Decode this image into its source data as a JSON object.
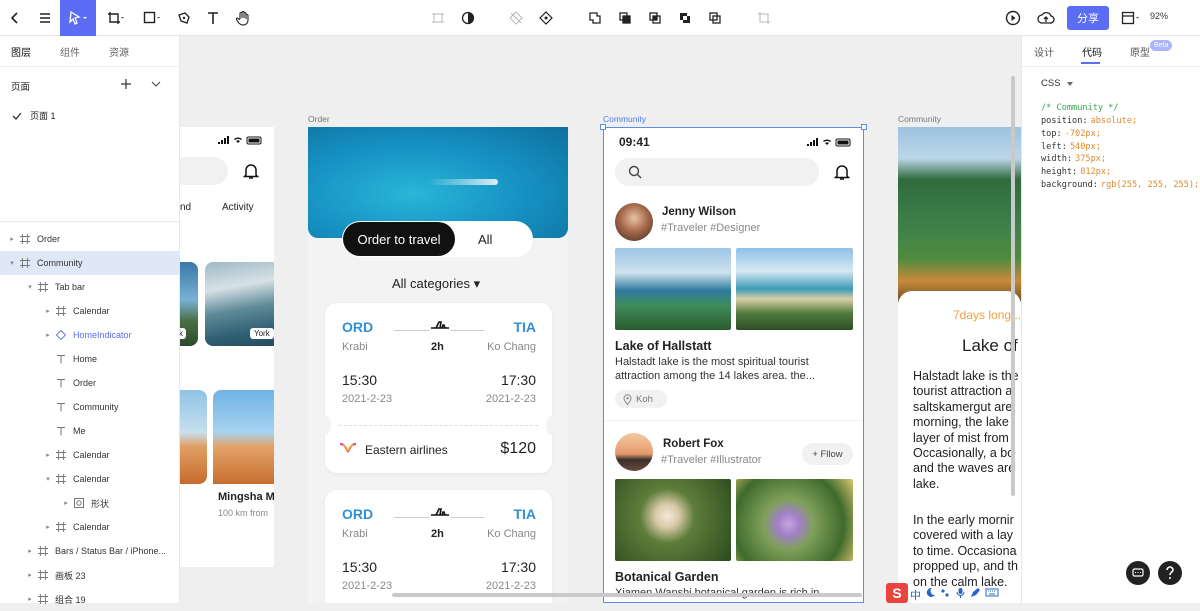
{
  "toolbar": {
    "share_label": "分享",
    "zoom": "92%"
  },
  "left_panel": {
    "tabs": [
      "图层",
      "组件",
      "资源"
    ],
    "pages_title": "页面",
    "pages": [
      "页面 1"
    ],
    "layers": [
      {
        "label": "Order",
        "level": 0,
        "caret": "▸",
        "icon": "frame"
      },
      {
        "label": "Community",
        "level": 0,
        "caret": "▾",
        "icon": "frame",
        "selected": true
      },
      {
        "label": "Tab bar",
        "level": 1,
        "caret": "▾",
        "icon": "frame"
      },
      {
        "label": "Calendar",
        "level": 2,
        "caret": "▸",
        "icon": "frame"
      },
      {
        "label": "HomeIndicator",
        "level": 2,
        "caret": "▸",
        "icon": "component",
        "accent": true
      },
      {
        "label": "Home",
        "level": 2,
        "caret": "",
        "icon": "text"
      },
      {
        "label": "Order",
        "level": 2,
        "caret": "",
        "icon": "text"
      },
      {
        "label": "Community",
        "level": 2,
        "caret": "",
        "icon": "text"
      },
      {
        "label": "Me",
        "level": 2,
        "caret": "",
        "icon": "text"
      },
      {
        "label": "Calendar",
        "level": 2,
        "caret": "▸",
        "icon": "frame"
      },
      {
        "label": "Calendar",
        "level": 2,
        "caret": "▾",
        "icon": "frame"
      },
      {
        "label": "形状",
        "level": 3,
        "caret": "▸",
        "icon": "shape"
      },
      {
        "label": "Calendar",
        "level": 2,
        "caret": "▸",
        "icon": "frame"
      },
      {
        "label": "Bars / Status Bar / iPhone...",
        "level": 1,
        "caret": "▸",
        "icon": "frame"
      },
      {
        "label": "画板 23",
        "level": 1,
        "caret": "▸",
        "icon": "frame"
      },
      {
        "label": "组合 19",
        "level": 1,
        "caret": "▸",
        "icon": "frame"
      }
    ]
  },
  "right_panel": {
    "tabs": [
      "设计",
      "代码",
      "原型"
    ],
    "beta": "Beta",
    "css_select": "CSS",
    "code": {
      "comment": "/* Community */",
      "lines": [
        {
          "prop": "position:",
          "val": "absolute;"
        },
        {
          "prop": "top:",
          "val": "-702px;"
        },
        {
          "prop": "left:",
          "val": "540px;"
        },
        {
          "prop": "width:",
          "val": "375px;"
        },
        {
          "prop": "height:",
          "val": "812px;"
        },
        {
          "prop": "background:",
          "val": "rgb(255, 255, 255);"
        }
      ]
    }
  },
  "canvas": {
    "labels": {
      "order": "Order",
      "community": "Community",
      "community2": "Community"
    },
    "left_phone": {
      "tab_partial": "nd",
      "tab_activity": "Activity",
      "card1": "k",
      "card2": "York",
      "trip_title": "Mingsha M",
      "trip_sub": "100 km from"
    },
    "order_phone": {
      "btn_order": "Order to travel",
      "btn_all": "All",
      "categories": "All categories ▾",
      "tickets": [
        {
          "from": "ORD",
          "to": "TIA",
          "from_city": "Krabi",
          "to_city": "Ko Chang",
          "duration": "2h",
          "dep_time": "15:30",
          "arr_time": "17:30",
          "dep_date": "2021-2-23",
          "arr_date": "2021-2-23",
          "airline": "Eastern airlines",
          "price": "$120"
        },
        {
          "from": "ORD",
          "to": "TIA",
          "from_city": "Krabi",
          "to_city": "Ko Chang",
          "duration": "2h",
          "dep_time": "15:30",
          "arr_time": "17:30",
          "dep_date": "2021-2-23",
          "arr_date": "2021-2-23"
        }
      ]
    },
    "community_phone": {
      "time": "09:41",
      "post1": {
        "name": "Jenny Wilson",
        "tags": "#Traveler  #Designer",
        "title": "Lake of Hallstatt",
        "body1": "Halstadt lake is the most spiritual tourist",
        "body2": "attraction among the 14 lakes  area. the...",
        "location": "Koh"
      },
      "post2": {
        "name": "Robert Fox",
        "tags": "#Traveler #Illustrator",
        "follow": "+ Fllow",
        "title": "Botanical Garden",
        "body1": "Xiamen Wanshi botanical garden is rich in"
      }
    },
    "right_phone": {
      "tag": "7days long...",
      "title": "Lake of",
      "para1": [
        "Halstadt lake is the",
        "tourist attraction a",
        "saltskamergut are",
        "morning, the lake i",
        "layer of mist from",
        "Occasionally, a bo",
        "and the waves are",
        "lake."
      ],
      "para2": [
        "In the early mornir",
        "covered with a lay",
        "to time. Occasiona",
        "propped up, and th",
        "on the calm lake."
      ]
    }
  }
}
